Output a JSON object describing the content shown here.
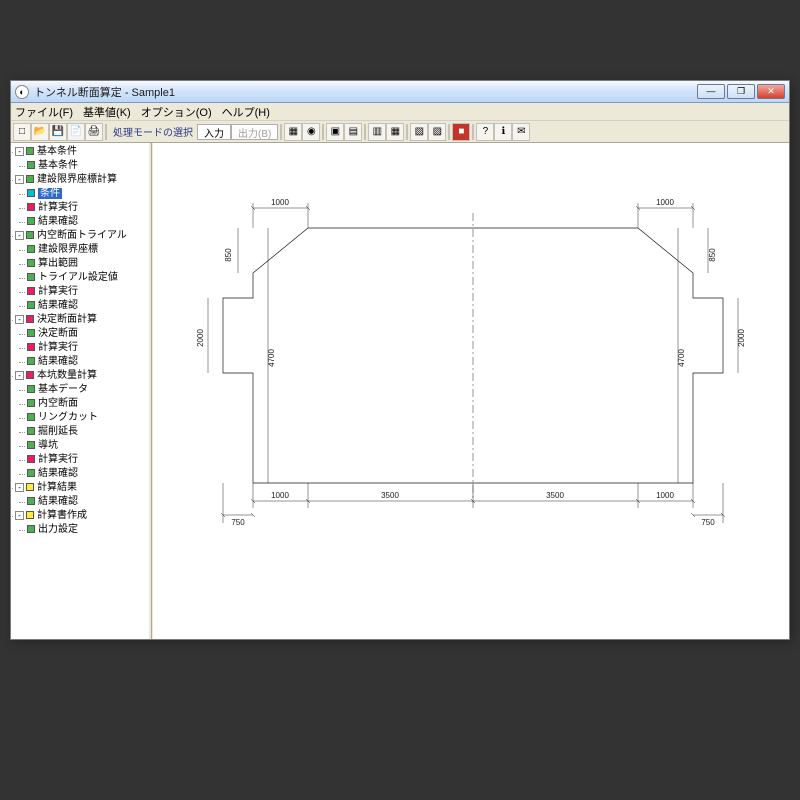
{
  "window": {
    "title": "トンネル断面算定 - Sample1"
  },
  "menu": {
    "file": "ファイル(F)",
    "standard": "基準値(K)",
    "option": "オプション(O)",
    "help": "ヘルプ(H)"
  },
  "toolbar": {
    "mode_label": "処理モードの選択",
    "input": "入力",
    "output": "出力(B)"
  },
  "tree": {
    "n0": "基本条件",
    "n0_0": "基本条件",
    "n1": "建設限界座標計算",
    "n1_0": "条件",
    "n1_1": "計算実行",
    "n1_2": "結果確認",
    "n2": "内空断面トライアル",
    "n2_0": "建設限界座標",
    "n2_1": "算出範囲",
    "n2_2": "トライアル設定値",
    "n2_3": "計算実行",
    "n2_4": "結果確認",
    "n3": "決定断面計算",
    "n3_0": "決定断面",
    "n3_1": "計算実行",
    "n3_2": "結果確認",
    "n4": "本坑数量計算",
    "n4_0": "基本データ",
    "n4_1": "内空断面",
    "n4_2": "リングカット",
    "n4_3": "掘削延長",
    "n4_4": "導坑",
    "n4_5": "計算実行",
    "n4_6": "結果確認",
    "n5": "計算結果",
    "n5_0": "結果確認",
    "n6": "計算書作成",
    "n6_0": "出力設定"
  },
  "dimensions": {
    "top_left": "1000",
    "top_right": "1000",
    "side_top_left": "850",
    "side_top_right": "850",
    "side_left": "2000",
    "side_right": "2000",
    "mid_left": "4700",
    "mid_right": "4700",
    "bottom_ext_left": "750",
    "bottom_ext_right": "750",
    "bottom_1": "1000",
    "bottom_2": "3500",
    "bottom_3": "3500",
    "bottom_4": "1000"
  }
}
